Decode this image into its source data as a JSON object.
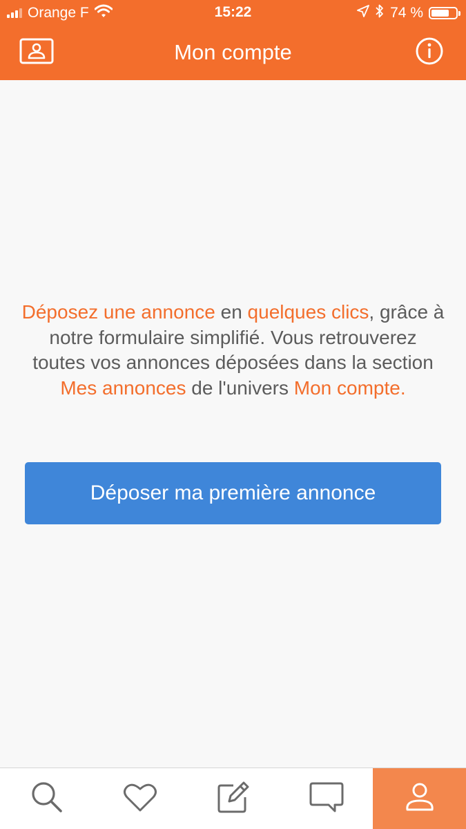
{
  "status_bar": {
    "carrier": "Orange F",
    "time": "15:22",
    "battery_percent": "74 %",
    "battery_level": 0.74,
    "icons": [
      "signal-icon",
      "wifi-icon",
      "location-arrow-icon",
      "bluetooth-icon",
      "battery-icon"
    ]
  },
  "header": {
    "title": "Mon compte",
    "left_icon": "account-card-icon",
    "right_icon": "info-icon"
  },
  "message": {
    "highlight_1": "Déposez une annonce",
    "text_1": " en ",
    "highlight_2": "quelques clics",
    "text_2": ", grâce à notre formulaire simplifié. Vous retrouverez toutes vos annonces déposées dans la section ",
    "highlight_3": "Mes annonces",
    "text_3": " de l'univers ",
    "highlight_4": "Mon compte."
  },
  "cta": {
    "label": "Déposer ma première annonce"
  },
  "tabbar": {
    "tabs": [
      {
        "icon": "search-icon",
        "active": false
      },
      {
        "icon": "heart-icon",
        "active": false
      },
      {
        "icon": "edit-icon",
        "active": false
      },
      {
        "icon": "chat-icon",
        "active": false
      },
      {
        "icon": "user-icon",
        "active": true
      }
    ]
  },
  "colors": {
    "brand_orange": "#f36e2c",
    "active_tab": "#f3874d",
    "button_blue": "#3f86d9",
    "body_text": "#5b5b5b",
    "icon_gray": "#6b6b6b"
  }
}
